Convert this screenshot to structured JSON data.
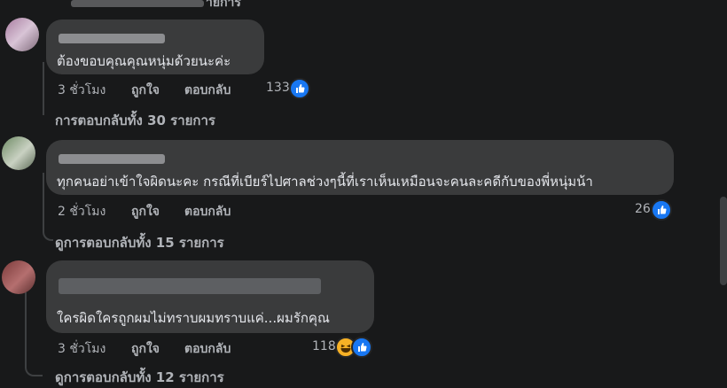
{
  "comments": [
    {
      "text": "ต้องขอบคุณคุณหนุ่มด้วยนะค่ะ",
      "time": "3 ชั่วโมง",
      "like": "ถูกใจ",
      "reply": "ตอบกลับ",
      "count": "133",
      "replies": "การตอบกลับทั้ง 30 รายการ"
    },
    {
      "text": "ทุกคนอย่าเข้าใจผิดนะคะ กรณีที่เบียร์ไปศาลช่วงๆนี้ที่เราเห็นเหมือนจะคนละคดีกับของพี่หนุ่มน้า",
      "time": "2 ชั่วโมง",
      "like": "ถูกใจ",
      "reply": "ตอบกลับ",
      "count": "26",
      "replies": "ดูการตอบกลับทั้ง 15 รายการ"
    },
    {
      "text": "ใครผิดใครถูกผมไม่ทราบผมทราบแค่...ผมรักคุณ",
      "time": "3 ชั่วโมง",
      "like": "ถูกใจ",
      "reply": "ตอบกลับ",
      "count": "118",
      "replies": "ดูการตอบกลับทั้ง 12 รายการ"
    }
  ],
  "top_partial": "ายการ",
  "icons": {
    "like": "like-icon",
    "haha": "haha-icon"
  },
  "colors": {
    "background": "#18191a",
    "bubble": "#3a3b3c",
    "like_blue": "#1877f2",
    "haha_yellow": "#f7b125"
  }
}
